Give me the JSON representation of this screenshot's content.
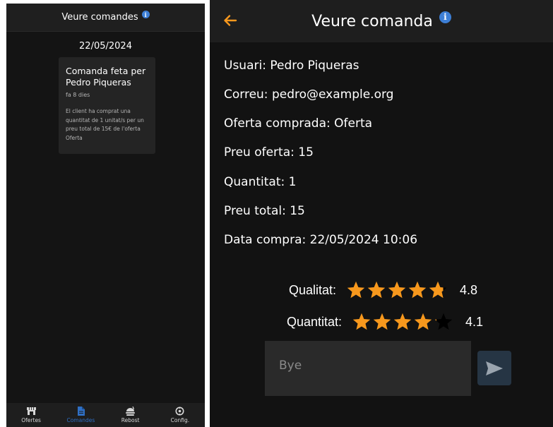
{
  "list_view": {
    "title": "Veure comandes",
    "date": "22/05/2024",
    "order_card": {
      "title": "Comanda feta per Pedro Piqueras",
      "age": "fa 8 dies",
      "description": "El client ha comprat una quantitat de 1 unitat/s per un preu total de 15€ de l'oferta Oferta"
    },
    "nav": [
      {
        "label": "Ofertes",
        "icon": "store-icon"
      },
      {
        "label": "Comandes",
        "icon": "document-icon",
        "active": true
      },
      {
        "label": "Rebost",
        "icon": "food-icon"
      },
      {
        "label": "Config.",
        "icon": "settings-icon"
      }
    ]
  },
  "detail_view": {
    "title": "Veure comanda",
    "fields": {
      "user": "Usuari: Pedro Piqueras",
      "email": "Correu: pedro@example.org",
      "offer": "Oferta comprada: Oferta",
      "offer_price": "Preu oferta: 15",
      "quantity": "Quantitat: 1",
      "total": "Preu total: 15",
      "date": "Data compra: 22/05/2024 10:06"
    },
    "ratings": {
      "quality": {
        "label": "Qualitat:",
        "value": "4.8",
        "score": 4.8
      },
      "quantity": {
        "label": "Quantitat:",
        "value": "4.1",
        "score": 4.1
      }
    },
    "message": {
      "placeholder": "Bye"
    }
  },
  "colors": {
    "accent_orange": "#f7981d",
    "active_blue": "#2f6fc4",
    "info_blue": "#3d7fd6",
    "send_button_bg": "#263544"
  }
}
